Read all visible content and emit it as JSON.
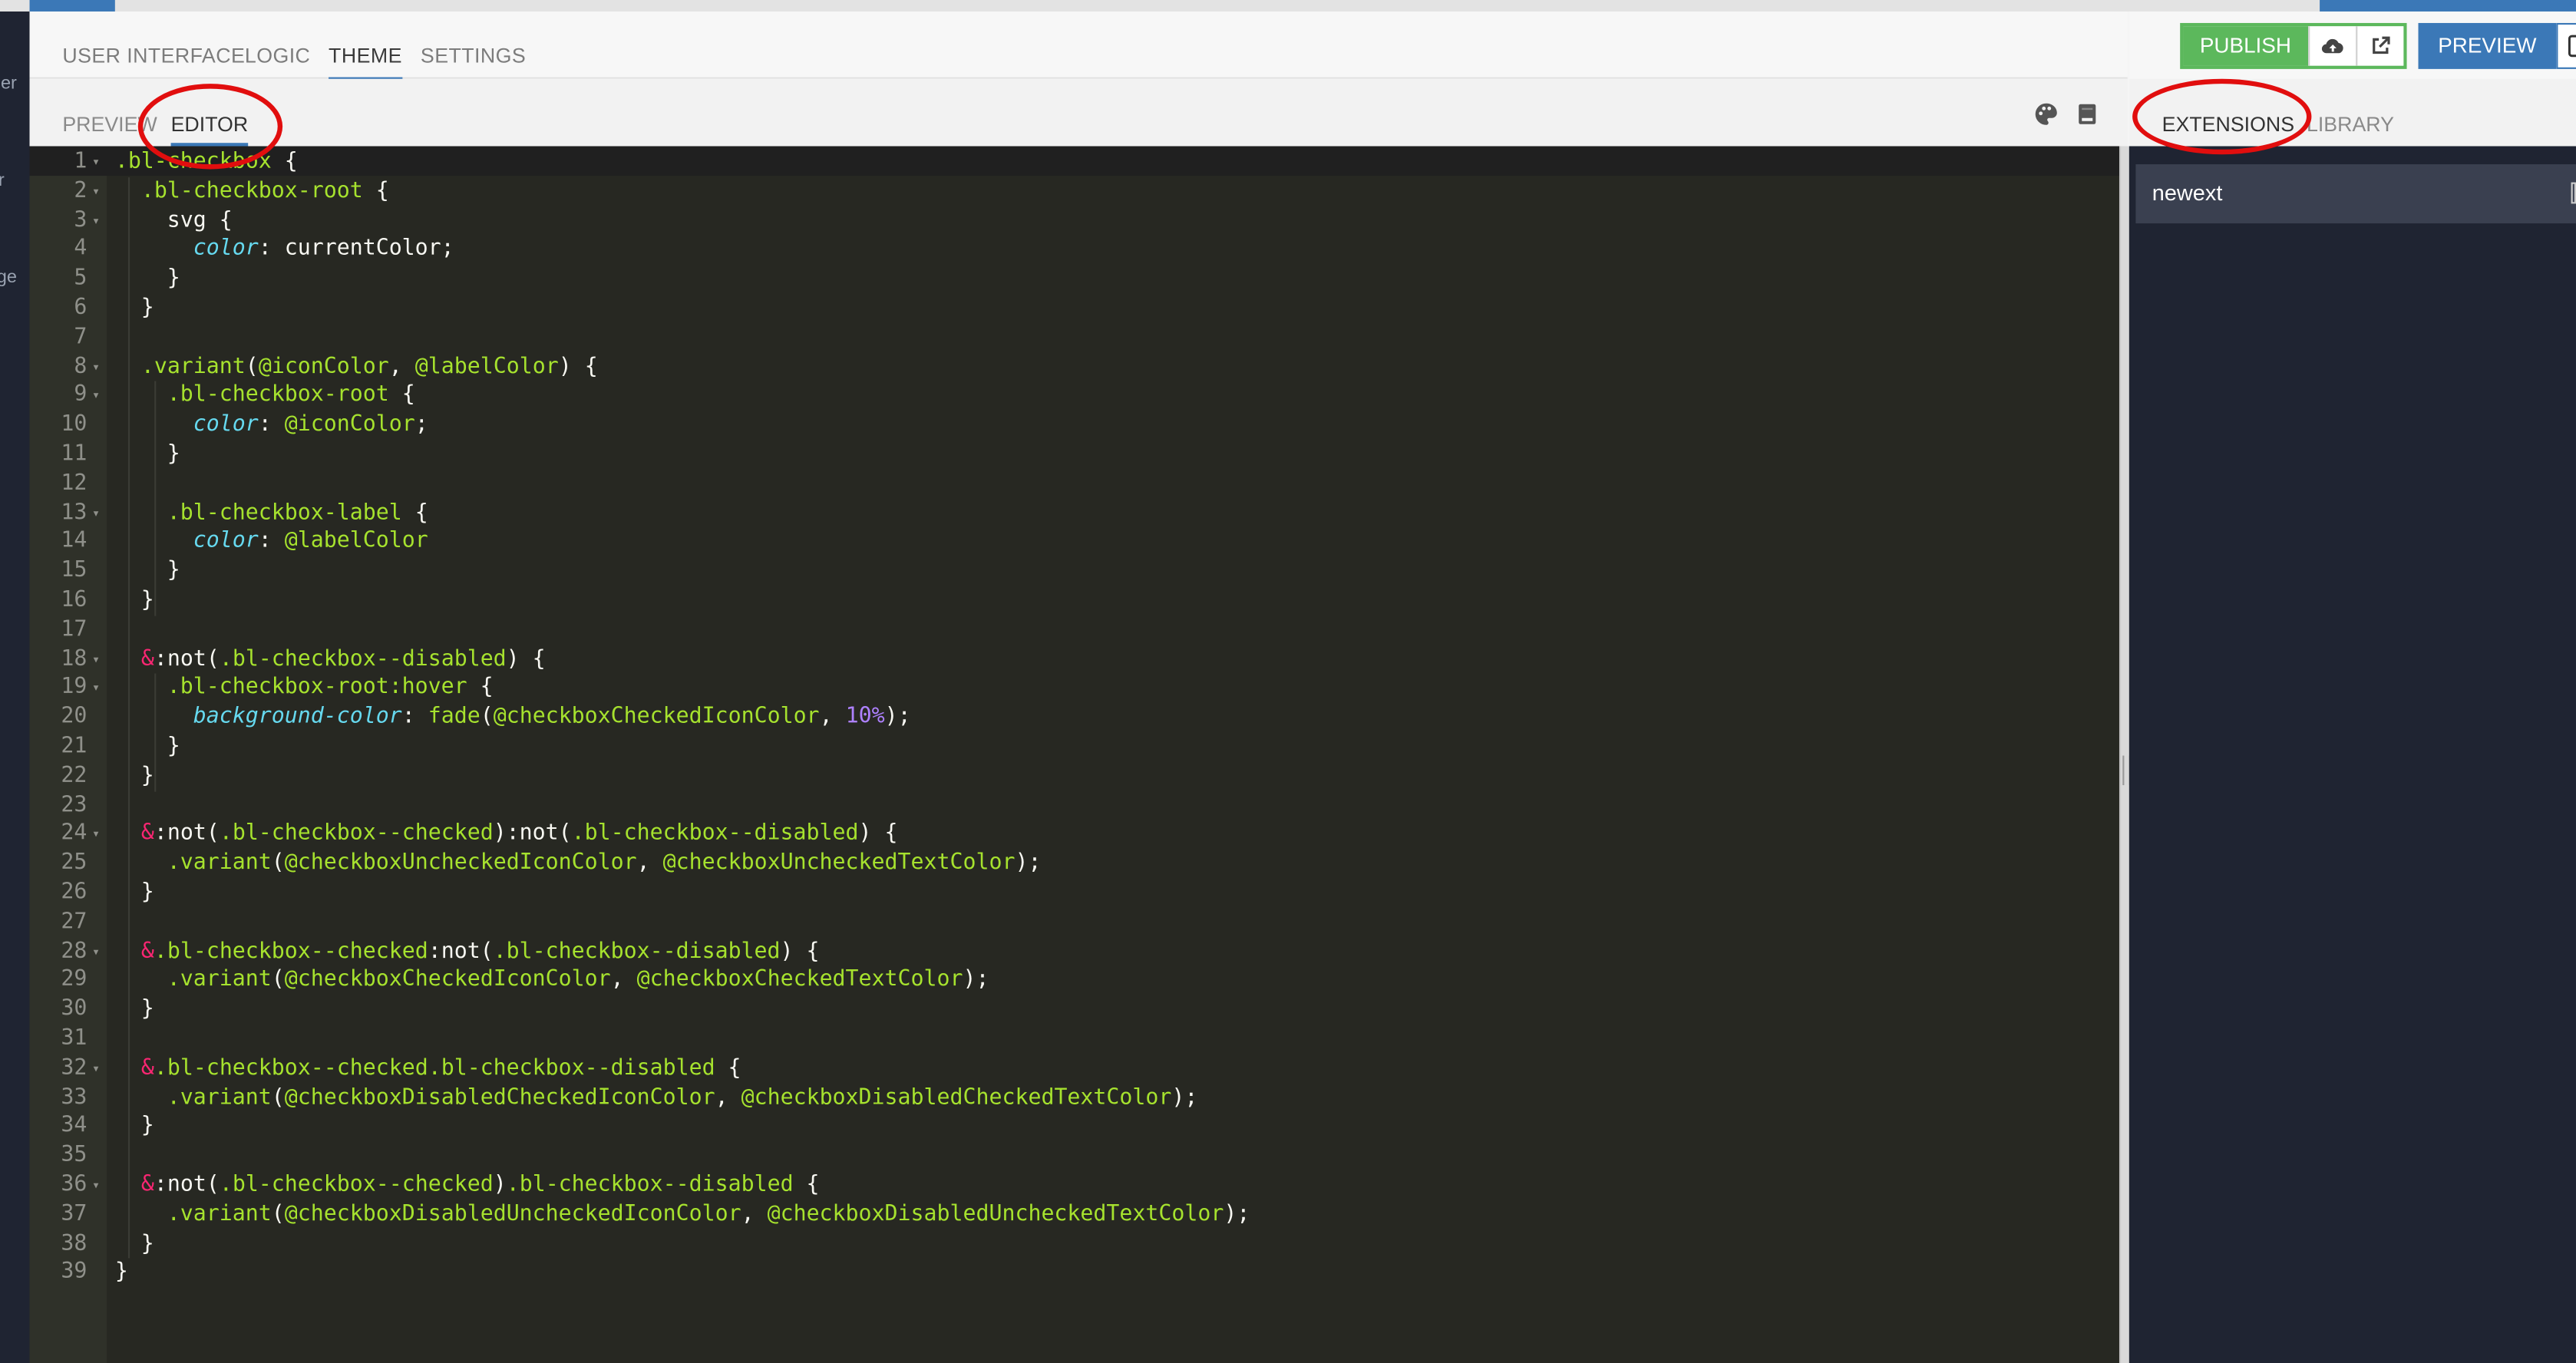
{
  "left_rail": {
    "fragments": [
      "ler",
      "r",
      "ge"
    ]
  },
  "main_tabs": [
    {
      "label": "USER INTERFACE",
      "active": false
    },
    {
      "label": "LOGIC",
      "active": false
    },
    {
      "label": "THEME",
      "active": true
    },
    {
      "label": "SETTINGS",
      "active": false
    }
  ],
  "sub_tabs": [
    {
      "label": "PREVIEW",
      "active": false
    },
    {
      "label": "EDITOR",
      "active": true
    }
  ],
  "toolbar_icons": [
    "palette-icon",
    "book-icon"
  ],
  "header_actions": {
    "publish_label": "PUBLISH",
    "publish_icons": [
      "cloud-upload-icon",
      "external-link-icon"
    ],
    "preview_label": "PREVIEW",
    "preview_icon": "mobile-device-icon",
    "publish_color": "#5cb85c",
    "preview_color": "#3b78b7"
  },
  "right_tabs": [
    {
      "label": "EXTENSIONS",
      "active": true
    },
    {
      "label": "LIBRARY",
      "active": false
    }
  ],
  "extensions": [
    {
      "name": "newext"
    }
  ],
  "colors": {
    "editor_bg": "#272822",
    "selector": "#a6e22e",
    "property": "#66d9ef",
    "ampersand": "#f92672",
    "number": "#ae81ff",
    "annotation": "#e10e0e"
  },
  "code_lines": [
    ".bl-checkbox {",
    "  .bl-checkbox-root {",
    "    svg {",
    "      color: currentColor;",
    "    }",
    "  }",
    "",
    "  .variant(@iconColor, @labelColor) {",
    "    .bl-checkbox-root {",
    "      color: @iconColor;",
    "    }",
    "",
    "    .bl-checkbox-label {",
    "      color: @labelColor",
    "    }",
    "  }",
    "",
    "  &:not(.bl-checkbox--disabled) {",
    "    .bl-checkbox-root:hover {",
    "      background-color: fade(@checkboxCheckedIconColor, 10%);",
    "    }",
    "  }",
    "",
    "  &:not(.bl-checkbox--checked):not(.bl-checkbox--disabled) {",
    "    .variant(@checkboxUncheckedIconColor, @checkboxUncheckedTextColor);",
    "  }",
    "",
    "  &.bl-checkbox--checked:not(.bl-checkbox--disabled) {",
    "    .variant(@checkboxCheckedIconColor, @checkboxCheckedTextColor);",
    "  }",
    "",
    "  &.bl-checkbox--checked.bl-checkbox--disabled {",
    "    .variant(@checkboxDisabledCheckedIconColor, @checkboxDisabledCheckedTextColor);",
    "  }",
    "",
    "  &:not(.bl-checkbox--checked).bl-checkbox--disabled {",
    "    .variant(@checkboxDisabledUncheckedIconColor, @checkboxDisabledUncheckedTextColor);",
    "  }",
    "}"
  ],
  "fold_lines": [
    1,
    2,
    3,
    8,
    9,
    13,
    18,
    19,
    24,
    28,
    32,
    36
  ]
}
